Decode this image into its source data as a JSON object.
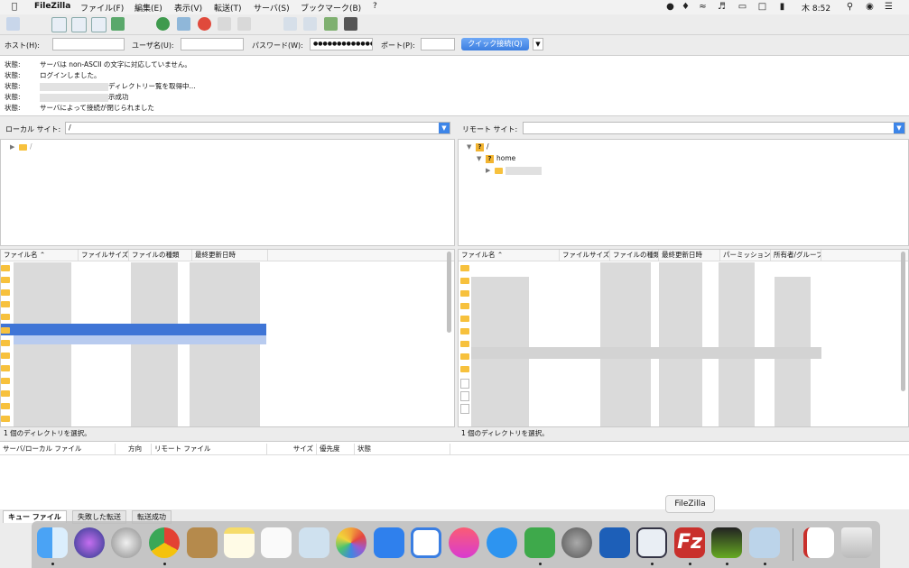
{
  "menubar": {
    "app_name": "FileZilla",
    "menus": [
      "ファイル(F)",
      "編集(E)",
      "表示(V)",
      "転送(T)",
      "サーバ(S)",
      "ブックマーク(B)",
      "?"
    ],
    "clock": "木 8:52"
  },
  "quickconnect": {
    "host_label": "ホスト(H):",
    "host_value": "",
    "user_label": "ユーザ名(U):",
    "user_value": "",
    "password_label": "パスワード(W):",
    "password_value": "●●●●●●●●●●●●●",
    "port_label": "ポート(P):",
    "port_value": "",
    "connect_button": "クイック接続(Q)"
  },
  "log": [
    {
      "key": "状態:",
      "msg": "サーバは non-ASCII の文字に対応していません。"
    },
    {
      "key": "状態:",
      "msg": "ログインしました。"
    },
    {
      "key": "状態:",
      "msg": "ディレクトリー覧を取得中..."
    },
    {
      "key": "状態:",
      "msg": "示成功"
    },
    {
      "key": "状態:",
      "msg": "サーバによって接続が閉じられました"
    }
  ],
  "local": {
    "site_label": "ローカル サイト:",
    "site_path": "/",
    "tree_root": "/",
    "columns": [
      "ファイル名",
      "ファイルサイズ",
      "ファイルの種類",
      "最終更新日時"
    ],
    "status": "1 個のディレクトリを選択。"
  },
  "remote": {
    "site_label": "リモート サイト:",
    "site_path": "",
    "tree_root": "/",
    "tree_home": "home",
    "columns": [
      "ファイル名",
      "ファイルサイズ",
      "ファイルの種類",
      "最終更新日時",
      "パーミッション",
      "所有者/グループ"
    ],
    "status": "1 個のディレクトリを選択。"
  },
  "queue": {
    "columns": [
      "サーバ/ローカル ファイル",
      "方向",
      "リモート ファイル",
      "サイズ",
      "優先度",
      "状態"
    ],
    "tabs": [
      "キュー ファイル",
      "失敗した転送",
      "転送成功"
    ]
  },
  "dock": {
    "tooltip": "FileZilla",
    "apps": [
      "finder",
      "siri",
      "launchpad",
      "chrome",
      "contacts",
      "notes",
      "reminders",
      "preview",
      "photos",
      "app-g",
      "app-sync",
      "itunes",
      "app-store",
      "evernote",
      "system-preferences",
      "remote-desktop",
      "monitor",
      "filezilla",
      "activity",
      "image-capture",
      "document",
      "trash"
    ]
  }
}
